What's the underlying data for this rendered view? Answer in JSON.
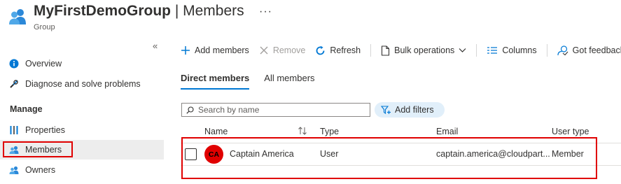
{
  "header": {
    "title_strong": "MyFirstDemoGroup",
    "title_light": " | Members",
    "more": "···",
    "subtitle": "Group",
    "icon": "group-icon"
  },
  "sidebar": {
    "collapse": "«",
    "items": [
      {
        "label": "Overview",
        "icon": "info-icon"
      },
      {
        "label": "Diagnose and solve problems",
        "icon": "wrench-icon"
      }
    ],
    "section": "Manage",
    "manage_items": [
      {
        "label": "Properties",
        "icon": "properties-icon"
      },
      {
        "label": "Members",
        "icon": "members-icon",
        "selected": true
      },
      {
        "label": "Owners",
        "icon": "owners-icon"
      }
    ]
  },
  "toolbar": {
    "add_members": "Add members",
    "remove": "Remove",
    "refresh": "Refresh",
    "bulk_operations": "Bulk operations",
    "columns": "Columns",
    "feedback": "Got feedback?"
  },
  "tabs": [
    {
      "label": "Direct members",
      "active": true
    },
    {
      "label": "All members",
      "active": false
    }
  ],
  "search": {
    "placeholder": "Search by name"
  },
  "filters": {
    "label": "Add filters"
  },
  "table": {
    "headers": [
      "Name",
      "Type",
      "Email",
      "User type"
    ],
    "rows": [
      {
        "initials": "CA",
        "name": "Captain America",
        "type": "User",
        "email": "captain.america@cloudpart...",
        "user_type": "Member"
      }
    ]
  },
  "colors": {
    "accent": "#0078d4",
    "highlight": "#e00000",
    "avatar": "#e00000"
  }
}
